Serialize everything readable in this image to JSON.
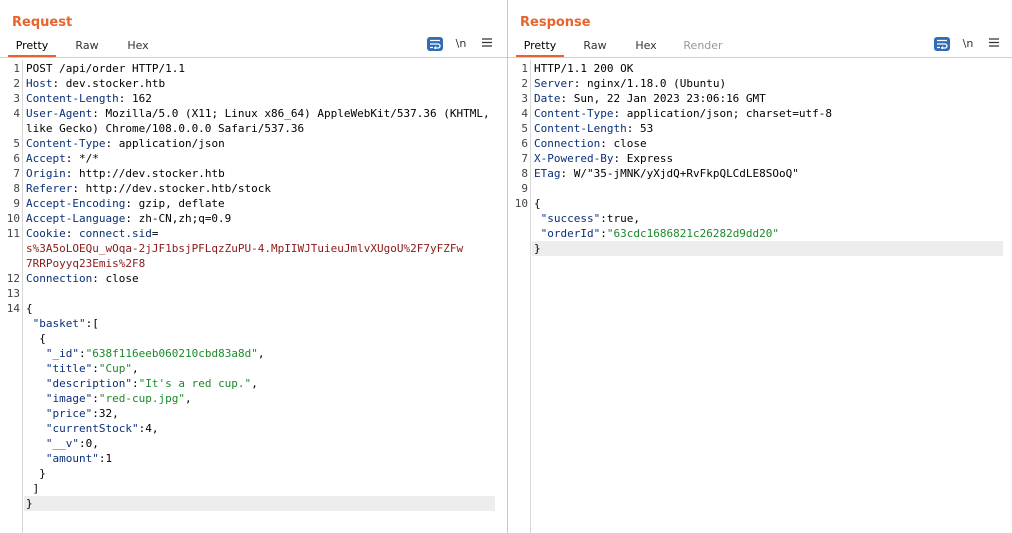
{
  "request": {
    "title": "Request",
    "tabs": [
      "Pretty",
      "Raw",
      "Hex"
    ],
    "active_tab": "Pretty",
    "newline_label": "\\n",
    "lines": [
      {
        "n": "1",
        "parts": [
          [
            "hv",
            "POST /api/order HTTP/1.1"
          ]
        ]
      },
      {
        "n": "2",
        "parts": [
          [
            "hn",
            "Host"
          ],
          [
            "hv",
            ": dev.stocker.htb"
          ]
        ]
      },
      {
        "n": "3",
        "parts": [
          [
            "hn",
            "Content-Length"
          ],
          [
            "hv",
            ": 162"
          ]
        ]
      },
      {
        "n": "4",
        "parts": [
          [
            "hn",
            "User-Agent"
          ],
          [
            "hv",
            ": Mozilla/5.0 (X11; Linux x86_64) AppleWebKit/537.36 (KHTML,"
          ]
        ]
      },
      {
        "n": "",
        "parts": [
          [
            "hv",
            "like Gecko) Chrome/108.0.0.0 Safari/537.36"
          ]
        ]
      },
      {
        "n": "5",
        "parts": [
          [
            "hn",
            "Content-Type"
          ],
          [
            "hv",
            ": application/json"
          ]
        ]
      },
      {
        "n": "6",
        "parts": [
          [
            "hn",
            "Accept"
          ],
          [
            "hv",
            ": */*"
          ]
        ]
      },
      {
        "n": "7",
        "parts": [
          [
            "hn",
            "Origin"
          ],
          [
            "hv",
            ": http://dev.stocker.htb"
          ]
        ]
      },
      {
        "n": "8",
        "parts": [
          [
            "hn",
            "Referer"
          ],
          [
            "hv",
            ": http://dev.stocker.htb/stock"
          ]
        ]
      },
      {
        "n": "9",
        "parts": [
          [
            "hn",
            "Accept-Encoding"
          ],
          [
            "hv",
            ": gzip, deflate"
          ]
        ]
      },
      {
        "n": "10",
        "parts": [
          [
            "hn",
            "Accept-Language"
          ],
          [
            "hv",
            ": zh-CN,zh;q=0.9"
          ]
        ]
      },
      {
        "n": "11",
        "parts": [
          [
            "hn",
            "Cookie"
          ],
          [
            "hv",
            ": "
          ],
          [
            "hn",
            "connect.sid"
          ],
          [
            "hv",
            "="
          ]
        ]
      },
      {
        "n": "",
        "parts": [
          [
            "ck",
            "s%3A5oLOEQu_wOqa-2jJF1bsjPFLqzZuPU-4.MpIIWJTuieuJmlvXUgoU%2F7yFZFw"
          ]
        ]
      },
      {
        "n": "",
        "parts": [
          [
            "ck",
            "7RRPoyyq23Emis%2F8"
          ]
        ]
      },
      {
        "n": "12",
        "parts": [
          [
            "hn",
            "Connection"
          ],
          [
            "hv",
            ": close"
          ]
        ]
      },
      {
        "n": "13",
        "parts": []
      },
      {
        "n": "14",
        "parts": [
          [
            "jn",
            "{"
          ]
        ]
      },
      {
        "n": "",
        "parts": [
          [
            "jn",
            " "
          ],
          [
            "jk",
            "\"basket\""
          ],
          [
            "jn",
            ":["
          ]
        ]
      },
      {
        "n": "",
        "parts": [
          [
            "jn",
            "  {"
          ]
        ]
      },
      {
        "n": "",
        "parts": [
          [
            "jn",
            "   "
          ],
          [
            "jk",
            "\"_id\""
          ],
          [
            "jn",
            ":"
          ],
          [
            "js",
            "\"638f116eeb060210cbd83a8d\""
          ],
          [
            "jn",
            ","
          ]
        ]
      },
      {
        "n": "",
        "parts": [
          [
            "jn",
            "   "
          ],
          [
            "jk",
            "\"title\""
          ],
          [
            "jn",
            ":"
          ],
          [
            "js",
            "\"Cup\""
          ],
          [
            "jn",
            ","
          ]
        ]
      },
      {
        "n": "",
        "parts": [
          [
            "jn",
            "   "
          ],
          [
            "jk",
            "\"description\""
          ],
          [
            "jn",
            ":"
          ],
          [
            "js",
            "\"It's a red cup.\""
          ],
          [
            "jn",
            ","
          ]
        ]
      },
      {
        "n": "",
        "parts": [
          [
            "jn",
            "   "
          ],
          [
            "jk",
            "\"image\""
          ],
          [
            "jn",
            ":"
          ],
          [
            "js",
            "\"red-cup.jpg\""
          ],
          [
            "jn",
            ","
          ]
        ]
      },
      {
        "n": "",
        "parts": [
          [
            "jn",
            "   "
          ],
          [
            "jk",
            "\"price\""
          ],
          [
            "jn",
            ":32,"
          ]
        ]
      },
      {
        "n": "",
        "parts": [
          [
            "jn",
            "   "
          ],
          [
            "jk",
            "\"currentStock\""
          ],
          [
            "jn",
            ":4,"
          ]
        ]
      },
      {
        "n": "",
        "parts": [
          [
            "jn",
            "   "
          ],
          [
            "jk",
            "\"__v\""
          ],
          [
            "jn",
            ":0,"
          ]
        ]
      },
      {
        "n": "",
        "parts": [
          [
            "jn",
            "   "
          ],
          [
            "jk",
            "\"amount\""
          ],
          [
            "jn",
            ":1"
          ]
        ]
      },
      {
        "n": "",
        "parts": [
          [
            "jn",
            "  }"
          ]
        ]
      },
      {
        "n": "",
        "parts": [
          [
            "jn",
            " ]"
          ]
        ]
      },
      {
        "n": "",
        "parts": [
          [
            "jn",
            "}"
          ]
        ],
        "highlight": true
      }
    ]
  },
  "response": {
    "title": "Response",
    "tabs": [
      "Pretty",
      "Raw",
      "Hex",
      "Render"
    ],
    "active_tab": "Pretty",
    "newline_label": "\\n",
    "lines": [
      {
        "n": "1",
        "parts": [
          [
            "hv",
            "HTTP/1.1 200 OK"
          ]
        ]
      },
      {
        "n": "2",
        "parts": [
          [
            "hn",
            "Server"
          ],
          [
            "hv",
            ": nginx/1.18.0 (Ubuntu)"
          ]
        ]
      },
      {
        "n": "3",
        "parts": [
          [
            "hn",
            "Date"
          ],
          [
            "hv",
            ": Sun, 22 Jan 2023 23:06:16 GMT"
          ]
        ]
      },
      {
        "n": "4",
        "parts": [
          [
            "hn",
            "Content-Type"
          ],
          [
            "hv",
            ": application/json; charset=utf-8"
          ]
        ]
      },
      {
        "n": "5",
        "parts": [
          [
            "hn",
            "Content-Length"
          ],
          [
            "hv",
            ": 53"
          ]
        ]
      },
      {
        "n": "6",
        "parts": [
          [
            "hn",
            "Connection"
          ],
          [
            "hv",
            ": close"
          ]
        ]
      },
      {
        "n": "7",
        "parts": [
          [
            "hn",
            "X-Powered-By"
          ],
          [
            "hv",
            ": Express"
          ]
        ]
      },
      {
        "n": "8",
        "parts": [
          [
            "hn",
            "ETag"
          ],
          [
            "hv",
            ": W/\"35-jMNK/yXjdQ+RvFkpQLCdLE8SOoQ\""
          ]
        ]
      },
      {
        "n": "9",
        "parts": []
      },
      {
        "n": "10",
        "parts": [
          [
            "jn",
            "{"
          ]
        ]
      },
      {
        "n": "",
        "parts": [
          [
            "jn",
            " "
          ],
          [
            "jk",
            "\"success\""
          ],
          [
            "jn",
            ":true,"
          ]
        ]
      },
      {
        "n": "",
        "parts": [
          [
            "jn",
            " "
          ],
          [
            "jk",
            "\"orderId\""
          ],
          [
            "jn",
            ":"
          ],
          [
            "js",
            "\"63cdc1686821c26282d9dd20\""
          ]
        ]
      },
      {
        "n": "",
        "parts": [
          [
            "jn",
            "}"
          ]
        ],
        "highlight": true
      }
    ]
  },
  "colors": {
    "accent": "#e8642b",
    "button_blue": "#2f6db5",
    "header_name": "#0a2f7a",
    "json_string": "#1a8a2a",
    "cookie_value": "#8a1a1a"
  },
  "icons": {
    "wrap": "word-wrap-icon",
    "menu": "hamburger-menu-icon",
    "layout_split": "split-layout-icon",
    "layout_horizontal": "horizontal-layout-icon",
    "layout_single": "single-layout-icon"
  }
}
